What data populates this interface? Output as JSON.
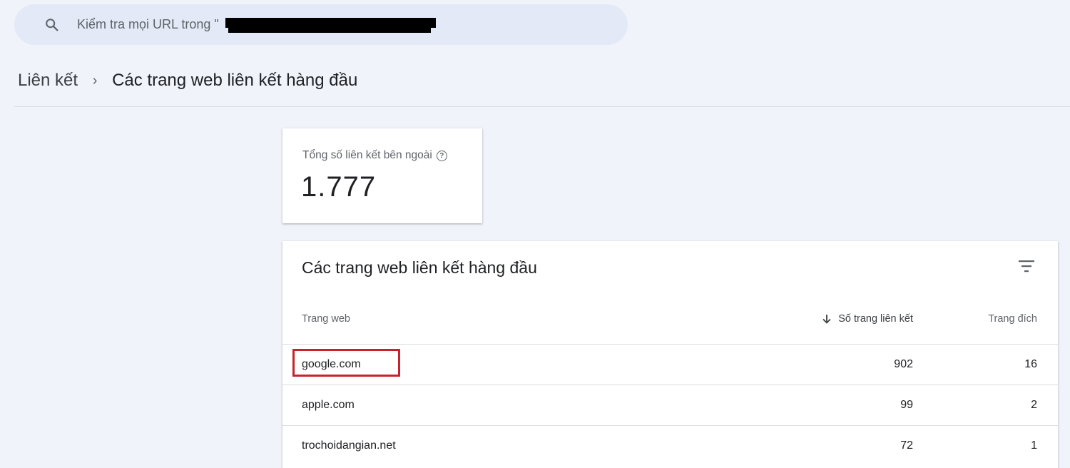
{
  "search": {
    "placeholder": "Kiểm tra mọi URL trong \""
  },
  "breadcrumb": {
    "root": "Liên kết",
    "separator": "›",
    "current": "Các trang web liên kết hàng đầu"
  },
  "summary": {
    "label": "Tổng số liên kết bên ngoài",
    "help_icon": "?",
    "value": "1.777"
  },
  "table": {
    "title": "Các trang web liên kết hàng đầu",
    "columns": {
      "site": "Trang web",
      "linking_pages": "Số trang liên kết",
      "target_pages": "Trang đích"
    },
    "sort": "descending by linking_pages",
    "rows": [
      {
        "site": "google.com",
        "linking_pages": "902",
        "target_pages": "16"
      },
      {
        "site": "apple.com",
        "linking_pages": "99",
        "target_pages": "2"
      },
      {
        "site": "trochoidangian.net",
        "linking_pages": "72",
        "target_pages": "1"
      }
    ]
  },
  "icons": [
    "search-icon",
    "help-icon",
    "filter-icon",
    "sort-down-arrow-icon"
  ],
  "colors": {
    "background": "#f1f3fb",
    "search_background": "#e3e9f6",
    "highlight_border": "#c8232c"
  }
}
